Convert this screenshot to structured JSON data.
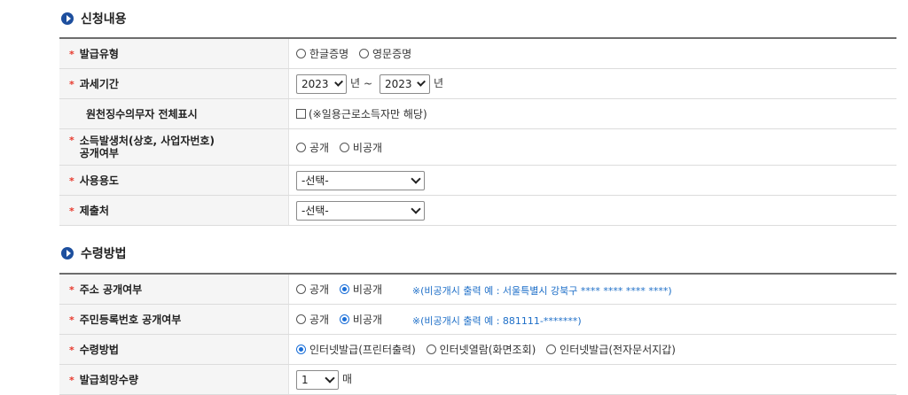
{
  "section1": {
    "title": "신청내용",
    "rows": {
      "type": {
        "label": "발급유형",
        "options": [
          "한글증명",
          "영문증명"
        ]
      },
      "period": {
        "label": "과세기간",
        "from_year": "2023",
        "to_year": "2023",
        "unit": "년",
        "separator": "~"
      },
      "withhold": {
        "label": "원천징수의무자 전체표시",
        "checkbox_label": "(※일용근로소득자만 해당)"
      },
      "income": {
        "label_line1": "소득발생처(상호, 사업자번호)",
        "label_line2": "공개여부",
        "options": [
          "공개",
          "비공개"
        ]
      },
      "purpose": {
        "label": "사용용도",
        "value": "-선택-"
      },
      "submit_to": {
        "label": "제출처",
        "value": "-선택-"
      }
    }
  },
  "section2": {
    "title": "수령방법",
    "rows": {
      "address": {
        "label": "주소 공개여부",
        "options": [
          "공개",
          "비공개"
        ],
        "selected": 1,
        "note": "※(비공개시 출력 예 : 서울특별시 강북구 **** **** **** ****)"
      },
      "rrn": {
        "label": "주민등록번호 공개여부",
        "options": [
          "공개",
          "비공개"
        ],
        "selected": 1,
        "note": "※(비공개시 출력 예 : 881111-*******)"
      },
      "method": {
        "label": "수령방법",
        "options": [
          "인터넷발급(프린터출력)",
          "인터넷열람(화면조회)",
          "인터넷발급(전자문서지갑)"
        ],
        "selected": 0
      },
      "count": {
        "label": "발급희망수량",
        "value": "1",
        "unit": "매"
      }
    }
  }
}
